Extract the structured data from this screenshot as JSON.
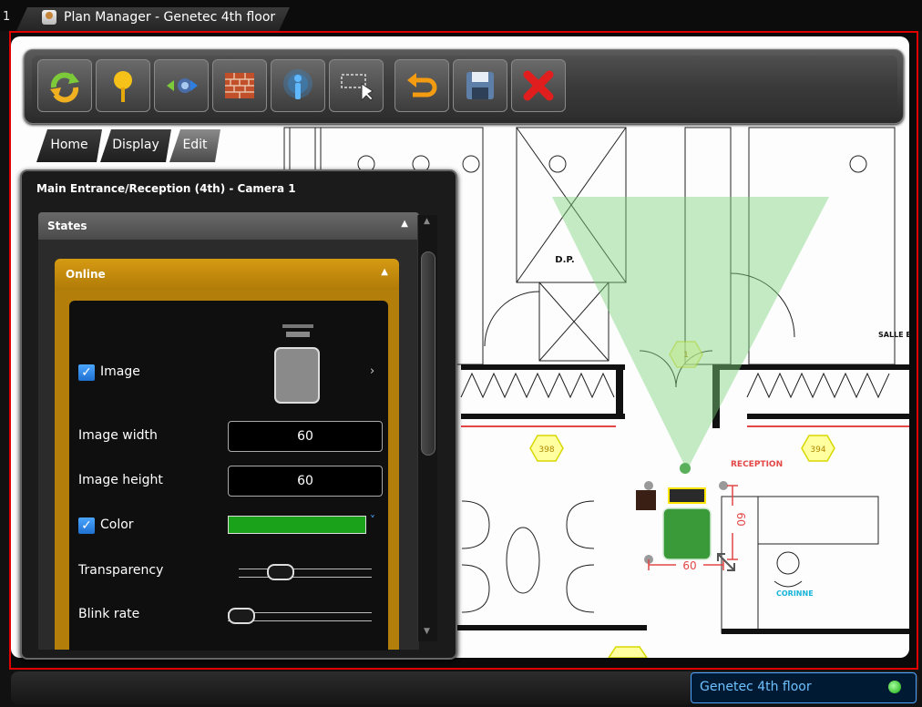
{
  "window": {
    "tab_number": "1",
    "title": "Plan Manager - Genetec 4th floor"
  },
  "toolbar": {
    "buttons": [
      {
        "name": "refresh-button",
        "icon": "refresh-arrows-icon"
      },
      {
        "name": "add-pin-button",
        "icon": "map-pin-icon"
      },
      {
        "name": "audio-button",
        "icon": "speaker-icon"
      },
      {
        "name": "wall-button",
        "icon": "brick-wall-icon"
      },
      {
        "name": "sensor-button",
        "icon": "broadcast-icon"
      },
      {
        "name": "select-region-button",
        "icon": "selection-cursor-icon"
      },
      {
        "name": "undo-button",
        "icon": "undo-icon"
      },
      {
        "name": "save-button",
        "icon": "floppy-disk-icon"
      },
      {
        "name": "close-button",
        "icon": "red-x-icon"
      }
    ]
  },
  "tabs": [
    {
      "label": "Home",
      "active": false
    },
    {
      "label": "Display",
      "active": false
    },
    {
      "label": "Edit",
      "active": true
    }
  ],
  "panel": {
    "title": "Main Entrance/Reception (4th) - Camera 1",
    "states_label": "States",
    "online_label": "Online",
    "image_label": "Image",
    "image_checked": true,
    "image_width_label": "Image width",
    "image_width_value": "60",
    "image_height_label": "Image height",
    "image_height_value": "60",
    "color_label": "Color",
    "color_checked": true,
    "color_value": "#1aa31a",
    "transparency_label": "Transparency",
    "transparency_level": 0.27,
    "blink_rate_label": "Blink rate",
    "blink_rate_level": 0.0
  },
  "map": {
    "labels": {
      "dp": "D.P.",
      "salle": "SALLE EL",
      "reception": "RECEPTION",
      "corinne": "CORINNE",
      "room_left": "398",
      "room_right": "394",
      "hex_top": "1",
      "dim_h": "60",
      "dim_v": "60"
    },
    "camera_color": "#3a9a3a",
    "cone_color": "#7dd37d"
  },
  "status": {
    "floor_name": "Genetec 4th floor"
  },
  "colors": {
    "frame_border": "#e00000",
    "accent_gold": "#c88d0e",
    "status_blue": "#6ec1ff"
  }
}
